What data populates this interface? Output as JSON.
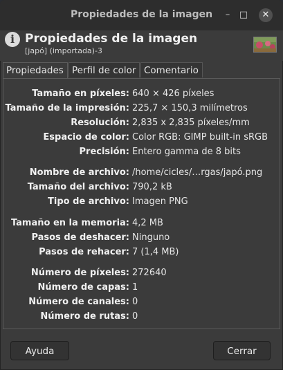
{
  "window": {
    "title": "Propiedades de la imagen",
    "controls": {
      "minimize": "–",
      "maximize": "□",
      "close": "✕"
    }
  },
  "header": {
    "title": "Propiedades de la imagen",
    "subtitle": "[japó] (importada)-3",
    "icon": "info-icon"
  },
  "tabs": [
    {
      "label": "Propiedades",
      "active": true
    },
    {
      "label": "Perfil de color",
      "active": false
    },
    {
      "label": "Comentario",
      "active": false
    }
  ],
  "properties": [
    {
      "key": "Tamaño en píxeles:",
      "value": "640 × 426 píxeles"
    },
    {
      "key": "Tamaño de la impresión:",
      "value": "225,7 × 150,3 milímetros"
    },
    {
      "key": "Resolución:",
      "value": "2,835 x 2,835 píxeles/mm"
    },
    {
      "key": "Espacio de color:",
      "value": "Color RGB: GIMP built-in sRGB"
    },
    {
      "key": "Precisión:",
      "value": "Entero gamma de 8 bits"
    },
    {
      "key": "Nombre de archivo:",
      "value": "/home/cicles/…rgas/japó.png"
    },
    {
      "key": "Tamaño del archivo:",
      "value": "790,2 kB"
    },
    {
      "key": "Tipo de archivo:",
      "value": "Imagen PNG"
    },
    {
      "key": "Tamaño en la memoria:",
      "value": "4,2 MB"
    },
    {
      "key": "Pasos de deshacer:",
      "value": "Ninguno"
    },
    {
      "key": "Pasos de rehacer:",
      "value": "7 (1,4 MB)"
    },
    {
      "key": "Número de píxeles:",
      "value": "272640"
    },
    {
      "key": "Número de capas:",
      "value": "1"
    },
    {
      "key": "Número de canales:",
      "value": "0"
    },
    {
      "key": "Número de rutas:",
      "value": "0"
    }
  ],
  "buttons": {
    "help": "Ayuda",
    "close": "Cerrar"
  }
}
